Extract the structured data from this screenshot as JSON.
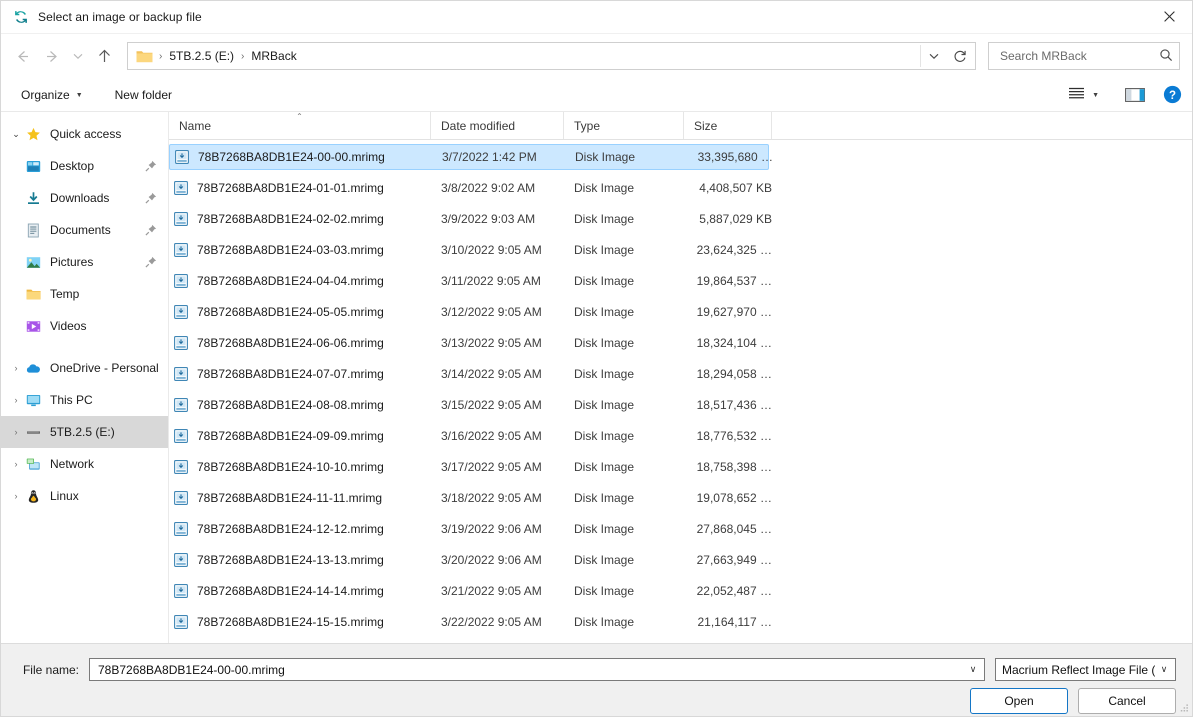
{
  "window": {
    "title": "Select an image or backup file",
    "title_icon": "macrium-reflect-icon",
    "close_label": "✕"
  },
  "nav": {
    "back": "←",
    "forward": "→",
    "recent": "∨",
    "up": "↑",
    "refresh_icon": "refresh-icon",
    "history_caret": "∨",
    "breadcrumb": [
      "5TB.2.5 (E:)",
      "MRBack"
    ],
    "separator": "›"
  },
  "search": {
    "placeholder": "Search MRBack",
    "value": "",
    "icon": "search-icon"
  },
  "toolbar": {
    "organize_label": "Organize",
    "organize_caret": "▼",
    "new_folder_label": "New folder",
    "view_icon": "view-list-icon",
    "view_caret": "▼",
    "preview_pane_icon": "preview-pane-icon",
    "help_icon": "help-icon",
    "help_glyph": "?"
  },
  "sidebar": {
    "groups": [
      {
        "name": "quick-access",
        "expanded": true,
        "chevron": "⌄",
        "label": "Quick access",
        "icon": "star-icon",
        "children": [
          {
            "label": "Desktop",
            "icon": "desktop-icon",
            "pinned": true
          },
          {
            "label": "Downloads",
            "icon": "downloads-icon",
            "pinned": true
          },
          {
            "label": "Documents",
            "icon": "documents-icon",
            "pinned": true
          },
          {
            "label": "Pictures",
            "icon": "pictures-icon",
            "pinned": true
          },
          {
            "label": "Temp",
            "icon": "folder-icon",
            "pinned": false
          },
          {
            "label": "Videos",
            "icon": "videos-icon",
            "pinned": false
          }
        ]
      }
    ],
    "roots": [
      {
        "label": "OneDrive - Personal",
        "icon": "onedrive-icon",
        "chevron": "›",
        "selected": false
      },
      {
        "label": "This PC",
        "icon": "thispc-icon",
        "chevron": "›",
        "selected": false
      },
      {
        "label": "5TB.2.5 (E:)",
        "icon": "drive-icon",
        "chevron": "›",
        "selected": true
      },
      {
        "label": "Network",
        "icon": "network-icon",
        "chevron": "›",
        "selected": false
      },
      {
        "label": "Linux",
        "icon": "linux-icon",
        "chevron": "›",
        "selected": false
      }
    ]
  },
  "filelist": {
    "columns": [
      {
        "key": "name",
        "label": "Name",
        "sorted": "asc",
        "sort_caret": "⌃"
      },
      {
        "key": "date",
        "label": "Date modified"
      },
      {
        "key": "type",
        "label": "Type"
      },
      {
        "key": "size",
        "label": "Size"
      }
    ],
    "rows": [
      {
        "name": "78B7268BA8DB1E24-00-00.mrimg",
        "date": "3/7/2022 1:42 PM",
        "type": "Disk Image",
        "size": "33,395,680 …",
        "icon": "disk-image-icon",
        "selected": true
      },
      {
        "name": "78B7268BA8DB1E24-01-01.mrimg",
        "date": "3/8/2022 9:02 AM",
        "type": "Disk Image",
        "size": "4,408,507 KB",
        "icon": "disk-image-icon",
        "selected": false
      },
      {
        "name": "78B7268BA8DB1E24-02-02.mrimg",
        "date": "3/9/2022 9:03 AM",
        "type": "Disk Image",
        "size": "5,887,029 KB",
        "icon": "disk-image-icon",
        "selected": false
      },
      {
        "name": "78B7268BA8DB1E24-03-03.mrimg",
        "date": "3/10/2022 9:05 AM",
        "type": "Disk Image",
        "size": "23,624,325 …",
        "icon": "disk-image-icon",
        "selected": false
      },
      {
        "name": "78B7268BA8DB1E24-04-04.mrimg",
        "date": "3/11/2022 9:05 AM",
        "type": "Disk Image",
        "size": "19,864,537 …",
        "icon": "disk-image-icon",
        "selected": false
      },
      {
        "name": "78B7268BA8DB1E24-05-05.mrimg",
        "date": "3/12/2022 9:05 AM",
        "type": "Disk Image",
        "size": "19,627,970 …",
        "icon": "disk-image-icon",
        "selected": false
      },
      {
        "name": "78B7268BA8DB1E24-06-06.mrimg",
        "date": "3/13/2022 9:05 AM",
        "type": "Disk Image",
        "size": "18,324,104 …",
        "icon": "disk-image-icon",
        "selected": false
      },
      {
        "name": "78B7268BA8DB1E24-07-07.mrimg",
        "date": "3/14/2022 9:05 AM",
        "type": "Disk Image",
        "size": "18,294,058 …",
        "icon": "disk-image-icon",
        "selected": false
      },
      {
        "name": "78B7268BA8DB1E24-08-08.mrimg",
        "date": "3/15/2022 9:05 AM",
        "type": "Disk Image",
        "size": "18,517,436 …",
        "icon": "disk-image-icon",
        "selected": false
      },
      {
        "name": "78B7268BA8DB1E24-09-09.mrimg",
        "date": "3/16/2022 9:05 AM",
        "type": "Disk Image",
        "size": "18,776,532 …",
        "icon": "disk-image-icon",
        "selected": false
      },
      {
        "name": "78B7268BA8DB1E24-10-10.mrimg",
        "date": "3/17/2022 9:05 AM",
        "type": "Disk Image",
        "size": "18,758,398 …",
        "icon": "disk-image-icon",
        "selected": false
      },
      {
        "name": "78B7268BA8DB1E24-11-11.mrimg",
        "date": "3/18/2022 9:05 AM",
        "type": "Disk Image",
        "size": "19,078,652 …",
        "icon": "disk-image-icon",
        "selected": false
      },
      {
        "name": "78B7268BA8DB1E24-12-12.mrimg",
        "date": "3/19/2022 9:06 AM",
        "type": "Disk Image",
        "size": "27,868,045 …",
        "icon": "disk-image-icon",
        "selected": false
      },
      {
        "name": "78B7268BA8DB1E24-13-13.mrimg",
        "date": "3/20/2022 9:06 AM",
        "type": "Disk Image",
        "size": "27,663,949 …",
        "icon": "disk-image-icon",
        "selected": false
      },
      {
        "name": "78B7268BA8DB1E24-14-14.mrimg",
        "date": "3/21/2022 9:05 AM",
        "type": "Disk Image",
        "size": "22,052,487 …",
        "icon": "disk-image-icon",
        "selected": false
      },
      {
        "name": "78B7268BA8DB1E24-15-15.mrimg",
        "date": "3/22/2022 9:05 AM",
        "type": "Disk Image",
        "size": "21,164,117 …",
        "icon": "disk-image-icon",
        "selected": false
      }
    ]
  },
  "footer": {
    "filename_label": "File name:",
    "filename_value": "78B7268BA8DB1E24-00-00.mrimg",
    "filename_caret": "∨",
    "filetype_value": "Macrium Reflect Image File (*.r",
    "filetype_caret": "∨",
    "open_label": "Open",
    "cancel_label": "Cancel"
  },
  "colors": {
    "accent": "#1476c6",
    "selection_fill": "#cce8ff",
    "selection_border": "#99d1ff",
    "sidebar_selected": "#d8d8d8",
    "footer_bg": "#f0f0f0",
    "macrium_teal": "#19a0a0",
    "folder_yellow": "#f6c453",
    "help_blue": "#0a7bd4"
  }
}
